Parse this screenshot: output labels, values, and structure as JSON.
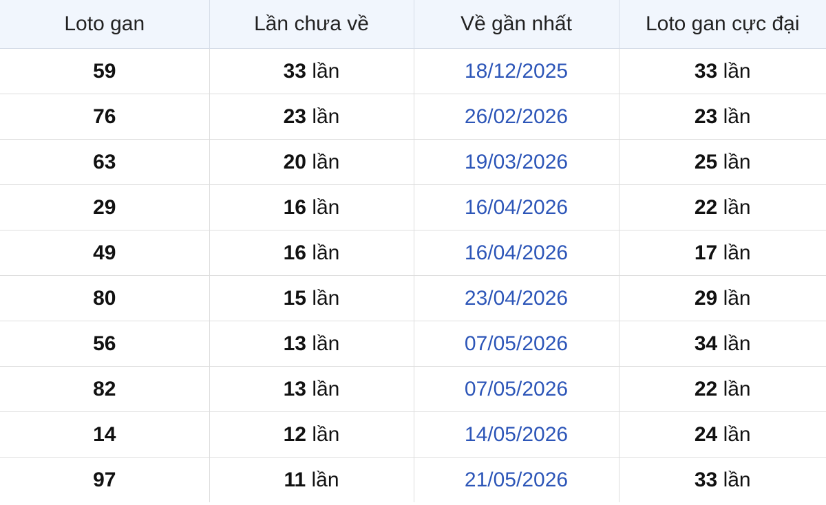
{
  "table": {
    "headers": [
      "Loto gan",
      "Lần chưa về",
      "Về gần nhất",
      "Loto gan cực đại"
    ],
    "unit": "lần",
    "rows": [
      {
        "loto": "59",
        "missed": "33",
        "last_date": "18/12/2025",
        "max": "33"
      },
      {
        "loto": "76",
        "missed": "23",
        "last_date": "26/02/2026",
        "max": "23"
      },
      {
        "loto": "63",
        "missed": "20",
        "last_date": "19/03/2026",
        "max": "25"
      },
      {
        "loto": "29",
        "missed": "16",
        "last_date": "16/04/2026",
        "max": "22"
      },
      {
        "loto": "49",
        "missed": "16",
        "last_date": "16/04/2026",
        "max": "17"
      },
      {
        "loto": "80",
        "missed": "15",
        "last_date": "23/04/2026",
        "max": "29"
      },
      {
        "loto": "56",
        "missed": "13",
        "last_date": "07/05/2026",
        "max": "34"
      },
      {
        "loto": "82",
        "missed": "13",
        "last_date": "07/05/2026",
        "max": "22"
      },
      {
        "loto": "14",
        "missed": "12",
        "last_date": "14/05/2026",
        "max": "24"
      },
      {
        "loto": "97",
        "missed": "11",
        "last_date": "21/05/2026",
        "max": "33"
      }
    ]
  },
  "colors": {
    "header_bg": "#f1f6fd",
    "date_text": "#2d56b8",
    "grid": "#dddddd"
  }
}
